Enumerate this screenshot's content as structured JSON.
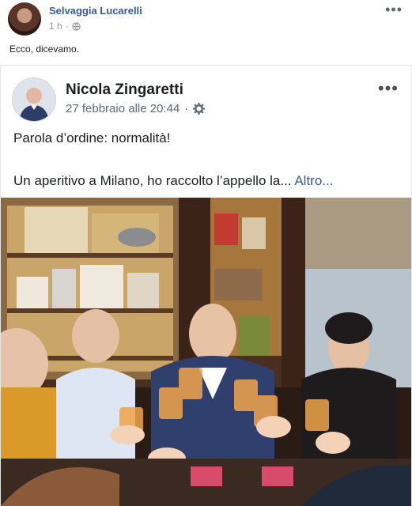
{
  "outer_post": {
    "author": "Selvaggia Lucarelli",
    "time": "1 h",
    "separator": "·",
    "more": "•••",
    "text": "Ecco, dicevamo."
  },
  "shared_post": {
    "author": "Nicola Zingaretti",
    "date": "27 febbraio alle 20:44",
    "separator": "·",
    "more": "•••",
    "line1": "Parola d’ordine: normalità!",
    "line2": "Un aperitivo a Milano, ho raccolto l’appello la...",
    "see_more": "Altro..."
  },
  "icons": {
    "privacy_outer": "globe-icon",
    "privacy_inner": "gear-icon",
    "menu": "more-icon"
  },
  "colors": {
    "link": "#385898",
    "meta": "#90949c",
    "text": "#1c1e21"
  }
}
